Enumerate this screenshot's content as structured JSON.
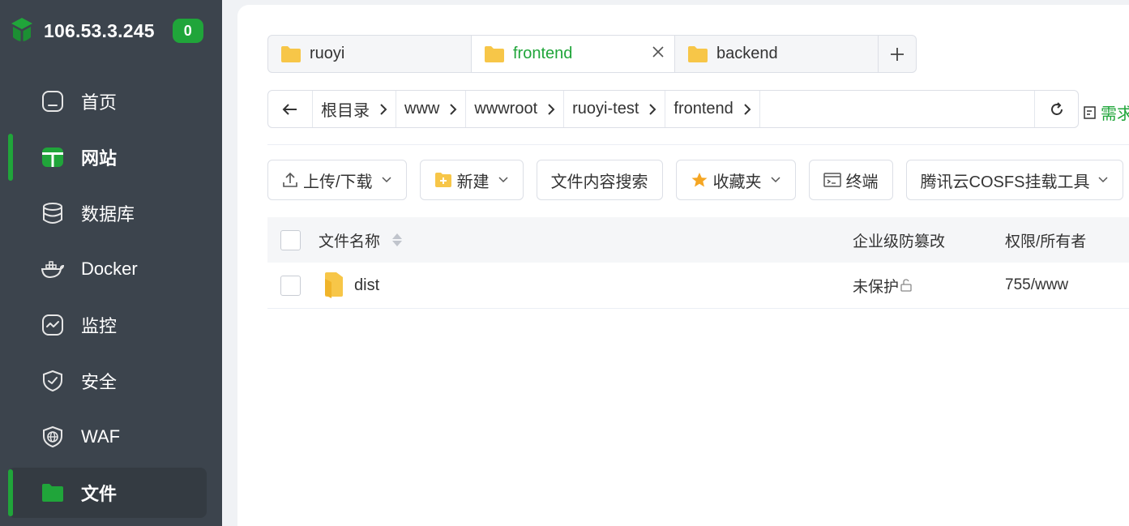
{
  "header": {
    "server_ip": "106.53.3.245",
    "badge_count": "0"
  },
  "sidebar": {
    "items": [
      {
        "label": "首页",
        "icon": "home-icon"
      },
      {
        "label": "网站",
        "icon": "website-icon"
      },
      {
        "label": "数据库",
        "icon": "database-icon"
      },
      {
        "label": "Docker",
        "icon": "docker-icon"
      },
      {
        "label": "监控",
        "icon": "monitor-icon"
      },
      {
        "label": "安全",
        "icon": "shield-icon"
      },
      {
        "label": "WAF",
        "icon": "waf-icon"
      },
      {
        "label": "文件",
        "icon": "folder-icon"
      }
    ]
  },
  "tabs": [
    {
      "label": "ruoyi"
    },
    {
      "label": "frontend"
    },
    {
      "label": "backend"
    }
  ],
  "path": {
    "crumbs": [
      "根目录",
      "www",
      "wwwroot",
      "ruoyi-test",
      "frontend"
    ],
    "requirements": "需求"
  },
  "toolbar": {
    "upload": "上传/下载",
    "new": "新建",
    "search": "文件内容搜索",
    "favorites": "收藏夹",
    "terminal": "终端",
    "cosfs": "腾讯云COSFS挂载工具"
  },
  "table": {
    "headers": {
      "name": "文件名称",
      "protection": "企业级防篡改",
      "permission": "权限/所有者"
    },
    "rows": [
      {
        "name": "dist",
        "protection": "未保护",
        "permission": "755/www"
      }
    ]
  },
  "colors": {
    "accent": "#20a53a",
    "sidebar_bg": "#3c444d",
    "folder": "#f7c648"
  }
}
